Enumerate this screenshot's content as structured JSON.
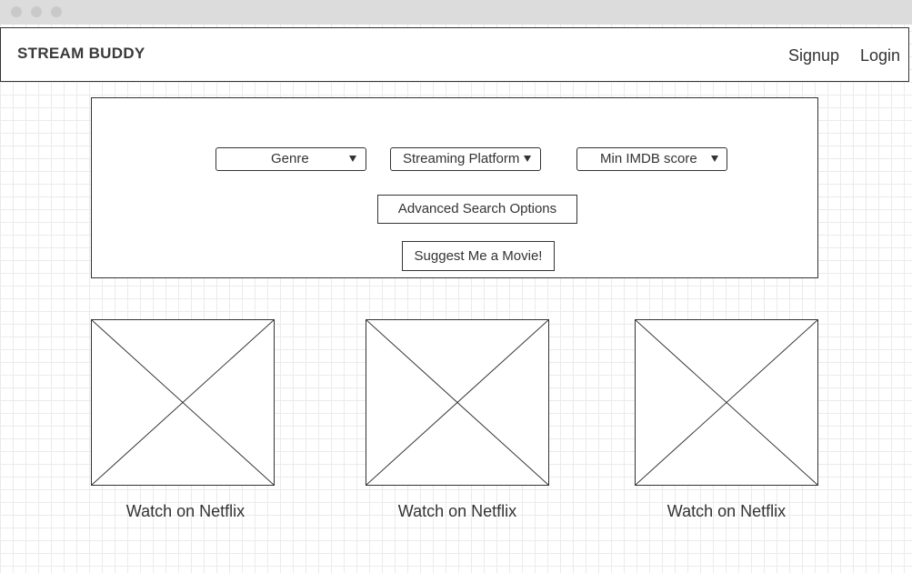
{
  "navbar": {
    "brand": "STREAM BUDDY",
    "signup_label": "Signup",
    "login_label": "Login"
  },
  "search": {
    "genre_label": "Genre",
    "platform_label": "Streaming Platform",
    "imdb_label": "Min IMDB score",
    "advanced_label": "Advanced Search Options",
    "suggest_label": "Suggest Me a Movie!"
  },
  "results": [
    {
      "link_label": "Watch on Netflix"
    },
    {
      "link_label": "Watch on Netflix"
    },
    {
      "link_label": "Watch on Netflix"
    }
  ]
}
